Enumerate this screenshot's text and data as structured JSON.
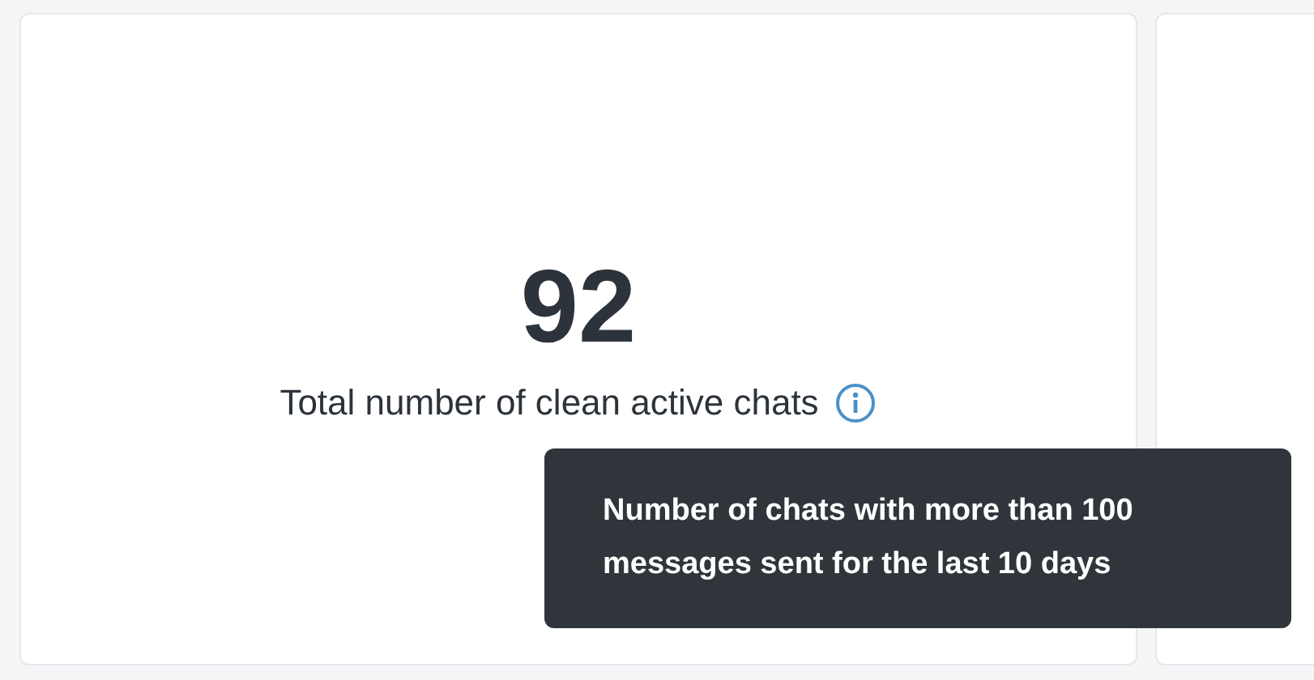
{
  "stat": {
    "value": "92",
    "label": "Total number of clean active chats"
  },
  "tooltip": {
    "text": "Number of chats with more than 100 messages sent for the last 10 days"
  }
}
